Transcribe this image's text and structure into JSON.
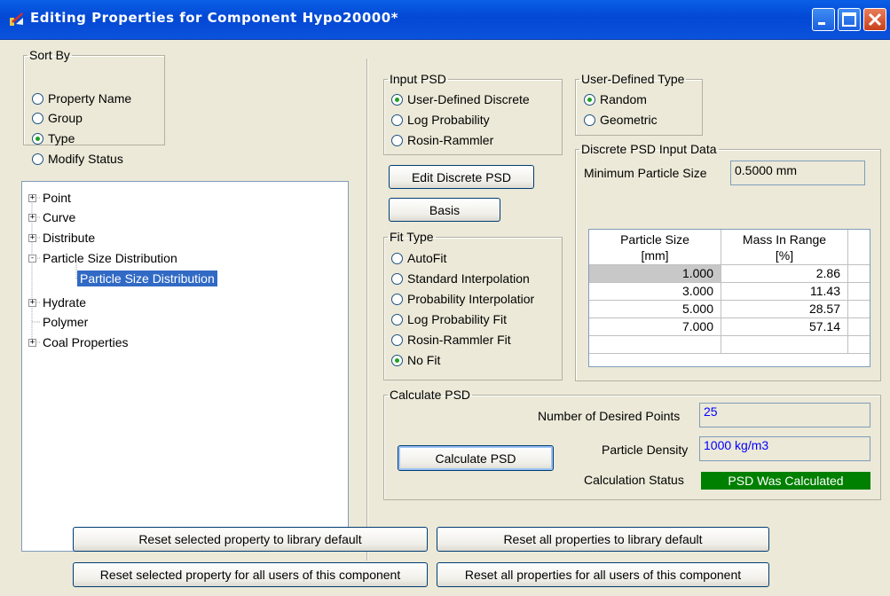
{
  "window": {
    "title": "Editing Properties for Component Hypo20000*",
    "controls": [
      "minimize-icon",
      "maximize-icon",
      "close-icon"
    ]
  },
  "sort_by": {
    "legend": "Sort By",
    "options": [
      "Property Name",
      "Group",
      "Type",
      "Modify Status"
    ],
    "selected": "Type"
  },
  "tree": {
    "items": [
      {
        "label": "Point",
        "expander": "+"
      },
      {
        "label": "Curve",
        "expander": "+"
      },
      {
        "label": "Distribute",
        "expander": "+"
      },
      {
        "label": "Particle Size Distribution",
        "expander": "-"
      },
      {
        "label": "Particle Size Distribution",
        "expander": "",
        "selected": true
      },
      {
        "label": "Hydrate",
        "expander": "+"
      },
      {
        "label": "Polymer",
        "expander": ""
      },
      {
        "label": "Coal Properties",
        "expander": "+"
      }
    ]
  },
  "input_psd": {
    "legend": "Input PSD",
    "options": [
      "User-Defined Discrete",
      "Log Probability",
      "Rosin-Rammler"
    ],
    "selected": "User-Defined Discrete"
  },
  "user_defined_type": {
    "legend": "User-Defined Type",
    "options": [
      "Random",
      "Geometric"
    ],
    "selected": "Random"
  },
  "buttons": {
    "edit_discrete": "Edit Discrete PSD",
    "basis": "Basis",
    "calculate": "Calculate PSD",
    "reset_selected_default": "Reset selected property to library default",
    "reset_all_default": "Reset all properties to library default",
    "reset_selected_users": "Reset selected property for all users of this component",
    "reset_all_users": "Reset all properties for all users of this component"
  },
  "fit_type": {
    "legend": "Fit Type",
    "options": [
      "AutoFit",
      "Standard Interpolation",
      "Probability Interpolatior",
      "Log Probability Fit",
      "Rosin-Rammler Fit",
      "No Fit"
    ],
    "selected": "No Fit"
  },
  "discrete_input": {
    "legend": "Discrete PSD Input Data",
    "min_size_label": "Minimum Particle Size",
    "min_size_value": "0.5000 mm",
    "table": {
      "headers": [
        [
          "Particle Size",
          "[mm]"
        ],
        [
          "Mass In Range",
          "[%]"
        ]
      ],
      "rows": [
        [
          "1.000",
          "2.86"
        ],
        [
          "3.000",
          "11.43"
        ],
        [
          "5.000",
          "28.57"
        ],
        [
          "7.000",
          "57.14"
        ]
      ]
    }
  },
  "calculate_psd": {
    "legend": "Calculate PSD",
    "points_label": "Number of Desired Points",
    "points_value": "25",
    "density_label": "Particle Density",
    "density_value": "1000 kg/m3",
    "status_label": "Calculation Status",
    "status_value": "PSD Was Calculated",
    "status_color": "#008000"
  }
}
